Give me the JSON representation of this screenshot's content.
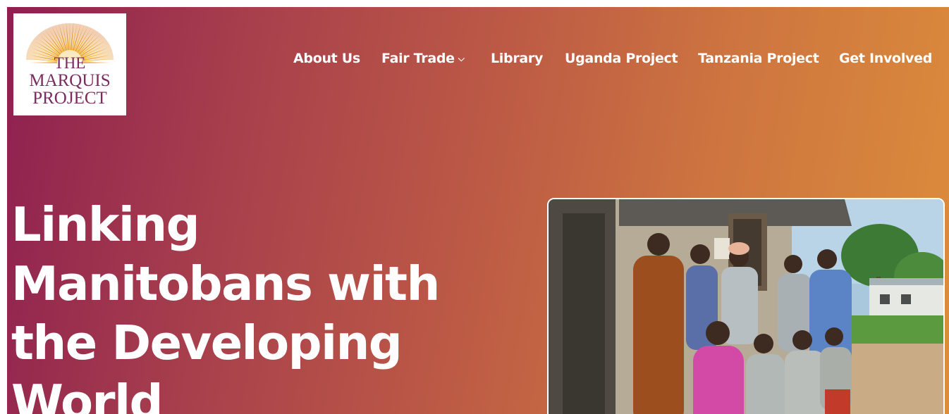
{
  "logo": {
    "line1": "THE",
    "line2": "MARQUIS",
    "line3": "PROJECT"
  },
  "nav": {
    "items": [
      {
        "label": "About Us"
      },
      {
        "label": "Fair Trade",
        "has_dropdown": true
      },
      {
        "label": "Library"
      },
      {
        "label": "Uganda Project"
      },
      {
        "label": "Tanzania Project"
      },
      {
        "label": "Get Involved"
      }
    ],
    "dropdown_icon": "chevron-down-icon"
  },
  "hero": {
    "headline_lines": [
      "Linking",
      "Manitobans with",
      "the Developing",
      "World"
    ],
    "gradient_start": "#8e2050",
    "gradient_end": "#dc8d3b",
    "text_color": "#ffffff"
  },
  "photo": {
    "subject": "group-photo-women"
  }
}
